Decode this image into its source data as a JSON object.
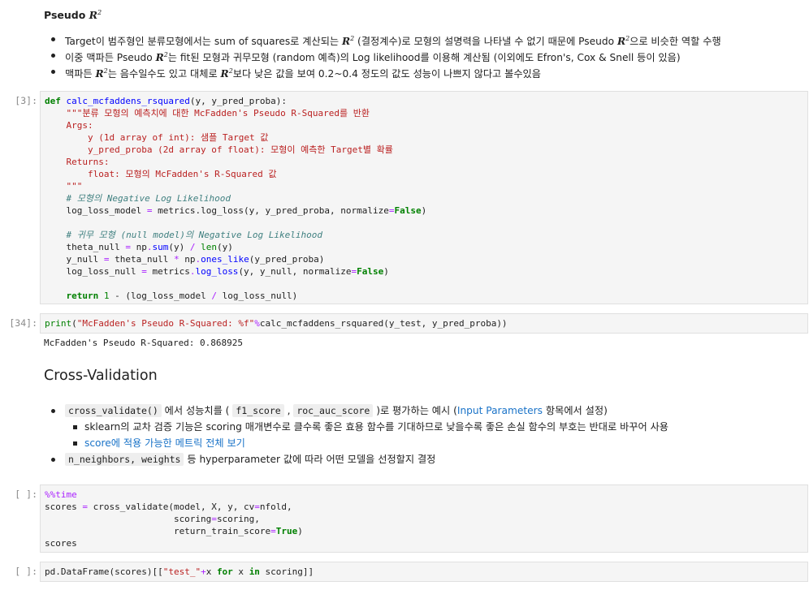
{
  "pseudo": {
    "title": "Pseudo",
    "r2_symbol": "R",
    "r2_sup": "2",
    "b1": {
      "t1": "Target이 범주형인 분류모형에서는 sum of squares로 계산되는 ",
      "t2": " (결정계수)로 모형의 설명력을 나타낼 수 없기 때문에 Pseudo ",
      "t3": "으로 비슷한 역할 수행"
    },
    "b2": {
      "t1": "이중 맥파든 Pseudo ",
      "t2": "는 fit된 모형과 귀무모형 (random 예측)의 Log likelihood를 이용해 계산됨 (이외에도 Efron's, Cox & Snell 등이 있음)"
    },
    "b3": {
      "t1": "맥파든 ",
      "t2": "는 음수일수도 있고 대체로 ",
      "t3": "보다 낮은 값을 보여 0.2~0.4 정도의 값도 성능이 나쁘지 않다고 볼수있음"
    }
  },
  "cells": {
    "c1": {
      "prompt": "[3]:",
      "l1a": "def",
      "l1b": "calc_mcfaddens_rsquared",
      "l1c": "(y, y_pred_proba):",
      "doc": [
        "    \"\"\"분류 모형의 예측치에 대한 McFadden's Pseudo R-Squared를 반환",
        "    Args:",
        "        y (1d array of int): 샘플 Target 값",
        "        y_pred_proba (2d array of float): 모형이 예측한 Target별 확률",
        "    Returns:",
        "        float: 모형의 McFadden's R-Squared 값",
        "    \"\"\""
      ],
      "cm1": "# 모형의 Negative Log Likelihood",
      "l9a": "    log_loss_model ",
      "l9b": "=",
      "l9c": " metrics.log_loss(y, y_pred_proba, normalize",
      "l9d": "=",
      "l9e": "False",
      "l9f": ")",
      "cm2": "# 귀무 모형 (null model)의 Negative Log Likelihood",
      "l12a": "    theta_null ",
      "l12b": "=",
      "l12c": " np",
      "l12d": ".",
      "l12e": "sum",
      "l12f": "(y) ",
      "l12g": "/",
      "l12h": " ",
      "l12i": "len",
      "l12j": "(y)",
      "l13a": "    y_null ",
      "l13b": "=",
      "l13c": " theta_null ",
      "l13d": "*",
      "l13e": " np",
      "l13f": ".",
      "l13g": "ones_like",
      "l13h": "(y_pred_proba)",
      "l14a": "    log_loss_null ",
      "l14b": "=",
      "l14c": " metrics",
      "l14d": ".",
      "l14e": "log_loss",
      "l14f": "(y, y_null, normalize",
      "l14g": "=",
      "l14h": "False",
      "l14i": ")",
      "l16a": "return",
      "l16b": "1",
      "l16c": " - (log_loss_model ",
      "l16d": "/",
      "l16e": " log_loss_null)"
    },
    "c2": {
      "prompt": "[34]:",
      "a": "print",
      "b": "(",
      "c": "\"McFadden's Pseudo R-Squared: %f\"",
      "d": "%",
      "e": "calc_mcfaddens_rsquared(y_test, y_pred_proba))",
      "output": "McFadden's Pseudo R-Squared: 0.868925"
    },
    "c3": {
      "prompt": "[ ]:",
      "magic": "%%time",
      "l2a": "scores ",
      "l2b": "=",
      "l2c": " cross_validate(model, X, y, cv",
      "l2d": "=",
      "l2e": "nfold,",
      "l3a": "                        scoring",
      "l3b": "=",
      "l3c": "scoring,",
      "l4a": "                        return_train_score",
      "l4b": "=",
      "l4c": "True",
      "l4d": ")",
      "l5": "scores"
    },
    "c4": {
      "prompt": "[ ]:",
      "a": "pd.DataFrame(scores)[[",
      "b": "\"test_\"",
      "c": "+",
      "d": "x ",
      "e": "for",
      "f": " x ",
      "g": "in",
      "h": " scoring]]"
    }
  },
  "cv": {
    "title": "Cross-Validation",
    "b1": {
      "code1": "cross_validate()",
      "t1": " 에서 성능치를 ( ",
      "code2": "f1_score",
      "t2": " , ",
      "code3": "roc_auc_score",
      "t3": " )로 평가하는 예시 (",
      "link": "Input Parameters",
      "t4": " 항목에서 설정)"
    },
    "b1a": "sklearn의 교차 검증 기능은 scoring 매개변수로 클수록 좋은 효용 함수를 기대하므로 낮을수록 좋은 손실 함수의 부호는 반대로 바꾸어 사용",
    "b1b": "score에 적용 가능한 메트릭 전체 보기",
    "b2": {
      "code": "n_neighbors, weights",
      "t": " 등 hyperparameter 값에 따라 어떤 모델을 선정할지 결정"
    }
  }
}
